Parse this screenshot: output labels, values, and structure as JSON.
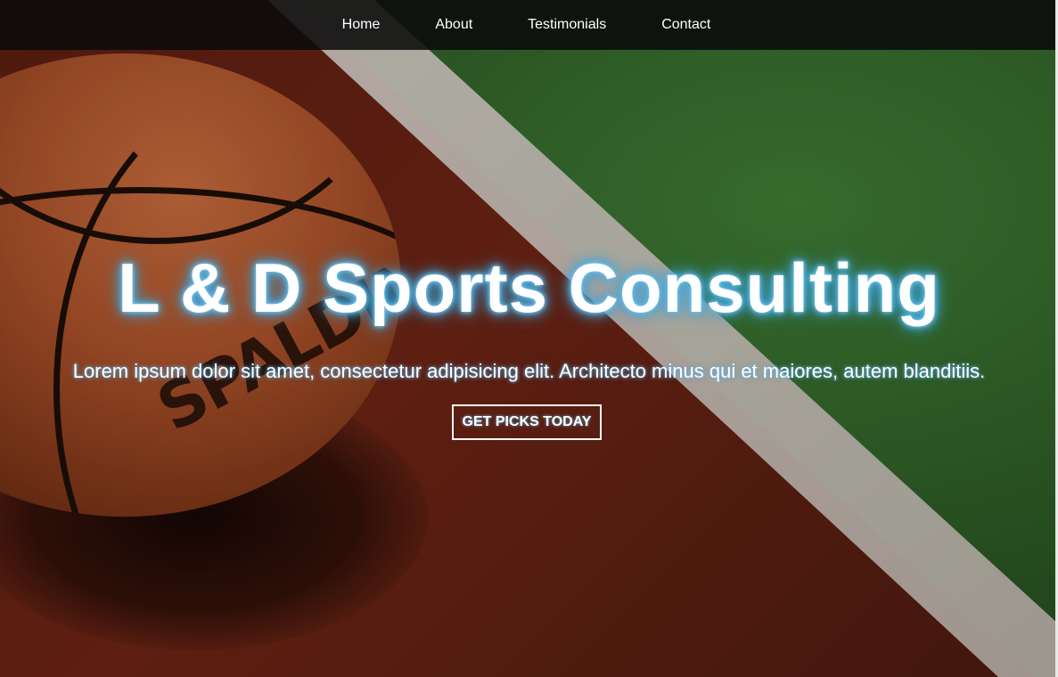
{
  "nav": {
    "items": [
      {
        "label": "Home"
      },
      {
        "label": "About"
      },
      {
        "label": "Testimonials"
      },
      {
        "label": "Contact"
      }
    ]
  },
  "hero": {
    "title": "L & D Sports Consulting",
    "subtitle": "Lorem ipsum dolor sit amet, consectetur adipisicing elit. Architecto minus qui et maiores, autem blanditiis.",
    "cta_label": "GET PICKS TODAY",
    "background": {
      "ball_brand_text": "SPALDING"
    }
  },
  "colors": {
    "nav_bg": "#0a0a0a",
    "title_glow": "#5bb8e8",
    "text": "#ffffff"
  }
}
